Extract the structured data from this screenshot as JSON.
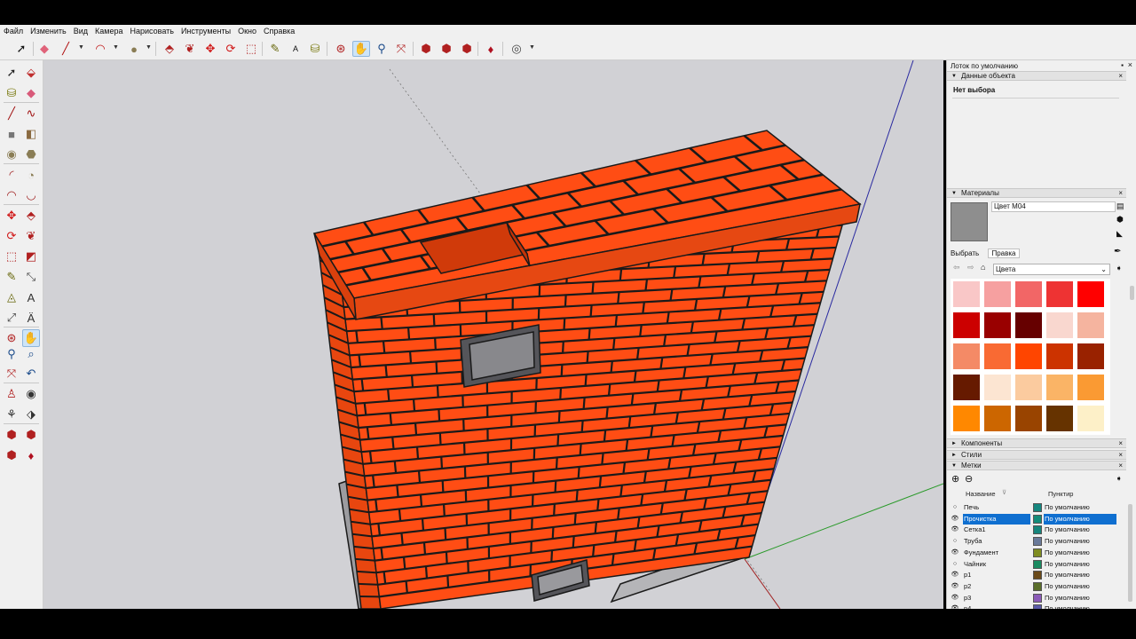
{
  "menu": [
    "Файл",
    "Изменить",
    "Вид",
    "Камера",
    "Нарисовать",
    "Инструменты",
    "Окно",
    "Справка"
  ],
  "toolbar": {
    "buttons": [
      "select-icon",
      "eraser-icon",
      "pencil-icon",
      "arc-icon",
      "shape-icon",
      "push-pull-icon",
      "follow-me-icon",
      "move-icon",
      "rotate-icon",
      "scale-icon",
      "tape-measure-icon",
      "text-icon",
      "paint-bucket-icon",
      "orbit-icon",
      "pan-icon",
      "zoom-icon",
      "zoom-extents-icon",
      "warehouse-icon",
      "extension-icon",
      "share-icon",
      "ruby-icon",
      "account-icon"
    ],
    "active": "pan-icon"
  },
  "left_tools": [
    "select-icon",
    "make-component-icon",
    "paint-bucket-icon",
    "eraser-icon",
    "line-icon",
    "freehand-icon",
    "rectangle-icon",
    "rotated-rectangle-icon",
    "circle-icon",
    "polygon-icon",
    "arc-icon",
    "pie-icon",
    "two-point-arc-icon",
    "three-point-arc-icon",
    "move-icon",
    "push-pull-icon",
    "rotate-icon",
    "follow-me-icon",
    "scale-icon",
    "offset-icon",
    "tape-measure-icon",
    "dimension-icon",
    "protractor-icon",
    "text-icon",
    "axes-icon",
    "3d-text-icon",
    "orbit-icon",
    "pan-icon",
    "zoom-icon",
    "zoom-window-icon",
    "zoom-extents-icon",
    "previous-view-icon",
    "position-camera-icon",
    "look-around-icon",
    "walk-icon",
    "section-plane-icon",
    "warehouse-icon",
    "extension-icon",
    "share-icon",
    "ruby-icon"
  ],
  "tray": {
    "title": "Лоток по умолчанию",
    "entity_info": {
      "header": "Данные объекта",
      "value": "Нет выбора"
    },
    "materials": {
      "header": "Материалы",
      "current_name": "Цвет M04",
      "tabs": [
        "Выбрать",
        "Правка"
      ],
      "active_tab": "Правка",
      "library": "Цвета",
      "swatches": [
        "#f9c7c7",
        "#f6a0a0",
        "#f26666",
        "#ee3333",
        "#ff0000",
        "#cc0000",
        "#990000",
        "#660000",
        "#f9d7cf",
        "#f5b49f",
        "#f48a66",
        "#f96a33",
        "#ff4500",
        "#cc3300",
        "#992200",
        "#661a00",
        "#fce5d2",
        "#fbcb9f",
        "#fab466",
        "#fa9a33",
        "#ff8800",
        "#cc6600",
        "#994400",
        "#663300",
        "#fdf0c8"
      ]
    },
    "components_header": "Компоненты",
    "styles_header": "Стили",
    "layers": {
      "header": "Метки",
      "col_name": "Название",
      "col_dash": "Пунктир",
      "rows": [
        {
          "name": "Печь",
          "color": "#15877f",
          "dash": "По умолчанию",
          "visible": false,
          "selected": false
        },
        {
          "name": "Прочистка",
          "color": "#138c7a",
          "dash": "По умолчанию",
          "visible": true,
          "selected": true
        },
        {
          "name": "Сетка1",
          "color": "#16857c",
          "dash": "По умолчанию",
          "visible": true,
          "selected": false
        },
        {
          "name": "Труба",
          "color": "#6a7a9a",
          "dash": "По умолчанию",
          "visible": false,
          "selected": false
        },
        {
          "name": "Фундамент",
          "color": "#7e8c20",
          "dash": "По умолчанию",
          "visible": true,
          "selected": false
        },
        {
          "name": "Чайник",
          "color": "#1a8a60",
          "dash": "По умолчанию",
          "visible": false,
          "selected": false
        },
        {
          "name": "р1",
          "color": "#6a4a1a",
          "dash": "По умолчанию",
          "visible": true,
          "selected": false
        },
        {
          "name": "р2",
          "color": "#5a6e2a",
          "dash": "По умолчанию",
          "visible": true,
          "selected": false
        },
        {
          "name": "р3",
          "color": "#8a5ab8",
          "dash": "По умолчанию",
          "visible": true,
          "selected": false
        },
        {
          "name": "р4",
          "color": "#5a5aa8",
          "dash": "По умолчанию",
          "visible": true,
          "selected": false
        }
      ]
    }
  },
  "scene": {
    "brick_color": "#ff4d14",
    "mortar_color": "#1a1a1a",
    "foundation_color": "#a8a8ac",
    "sky_color": "#d1d1d5"
  }
}
